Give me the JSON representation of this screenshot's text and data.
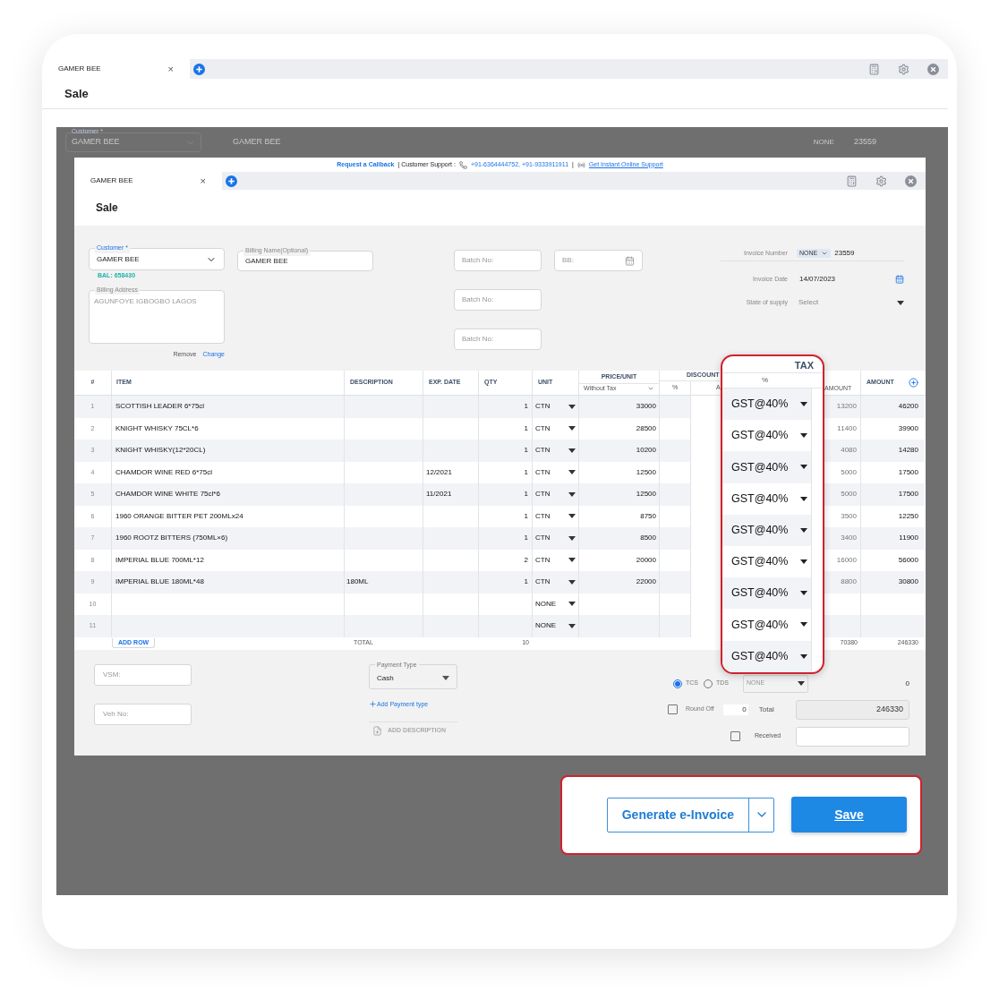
{
  "app": {
    "tab": "GAMER BEE",
    "close": "×",
    "title": "Sale"
  },
  "background_form": {
    "customer_label": "Customer *",
    "customer": "GAMER BEE",
    "billing_name": "GAMER BEE",
    "invoice_prefix": "NONE",
    "invoice_number": "23559"
  },
  "support_bar": {
    "callback": "Request a Callback",
    "label": "| Customer Support :",
    "phones": "+91-6364444752, +91-9333911911",
    "separator": "|",
    "online": "Get Instant Online Support"
  },
  "window": {
    "tab": "GAMER BEE",
    "close": "×",
    "title": "Sale"
  },
  "form": {
    "customer_label": "Customer *",
    "customer": "GAMER BEE",
    "balance": "BAL: 658430",
    "billing_name_label": "Billing Name(Optional)",
    "billing_name": "GAMER BEE",
    "address_label": "Billing Address",
    "address": "AGUNFOYE IGBOGBO LAGOS",
    "remove": "Remove",
    "change": "Change",
    "batch_fields": [
      "Batch No:",
      "Batch No:",
      "Batch No:"
    ],
    "bb_field": "BB:",
    "invoice_number_label": "Invoice Number",
    "invoice_prefix": "NONE",
    "invoice_number": "23559",
    "invoice_date_label": "Invoice Date",
    "invoice_date": "14/07/2023",
    "state_label": "State of supply",
    "state": "Select"
  },
  "table": {
    "header": {
      "number": "#",
      "item": "ITEM",
      "description": "DESCRIPTION",
      "exp_date": "EXP. DATE",
      "qty": "QTY",
      "unit": "UNIT",
      "price": "PRICE/UNIT",
      "price_mode": "Without Tax",
      "discount": "DISCOUNT",
      "discount_percent": "%",
      "discount_amount": "A",
      "tax_amount": "AMOUNT",
      "amount": "AMOUNT"
    },
    "rows": [
      {
        "number": "1",
        "item": "SCOTTISH LEADER 6*75cl",
        "qty": "1",
        "unit": "CTN",
        "price": "33000",
        "tax_amount": "13200",
        "amount": "46200"
      },
      {
        "number": "2",
        "item": "KNIGHT WHISKY 75CL*6",
        "qty": "1",
        "unit": "CTN",
        "price": "28500",
        "tax_amount": "11400",
        "amount": "39900"
      },
      {
        "number": "3",
        "item": "KNIGHT WHISKY(12*20CL)",
        "qty": "1",
        "unit": "CTN",
        "price": "10200",
        "tax_amount": "4080",
        "amount": "14280"
      },
      {
        "number": "4",
        "item": "CHAMDOR WINE RED 6*75cl",
        "exp_date": "12/2021",
        "qty": "1",
        "unit": "CTN",
        "price": "12500",
        "tax_amount": "5000",
        "amount": "17500"
      },
      {
        "number": "5",
        "item": "CHAMDOR WINE WHITE 75cl*6",
        "exp_date": "11/2021",
        "qty": "1",
        "unit": "CTN",
        "price": "12500",
        "tax_amount": "5000",
        "amount": "17500"
      },
      {
        "number": "6",
        "item": "1960 ORANGE BITTER PET 200MLx24",
        "qty": "1",
        "unit": "CTN",
        "price": "8750",
        "tax_amount": "3500",
        "amount": "12250"
      },
      {
        "number": "7",
        "item": "1960 ROOTZ BITTERS (750ML×6)",
        "qty": "1",
        "unit": "CTN",
        "price": "8500",
        "tax_amount": "3400",
        "amount": "11900"
      },
      {
        "number": "8",
        "item": "IMPERIAL BLUE 700ML*12",
        "qty": "2",
        "unit": "CTN",
        "price": "20000",
        "tax_amount": "16000",
        "amount": "56000"
      },
      {
        "number": "9",
        "item": "IMPERIAL BLUE 180ML*48",
        "description": "180ML",
        "qty": "1",
        "unit": "CTN",
        "price": "22000",
        "tax_amount": "8800",
        "amount": "30800"
      },
      {
        "number": "10",
        "unit": "NONE"
      },
      {
        "number": "11",
        "unit": "NONE"
      }
    ],
    "total": {
      "add_row": "ADD ROW",
      "label": "TOTAL",
      "qty": "10",
      "tax_amount": "70380",
      "amount": "246330"
    }
  },
  "tax_overlay": {
    "title": "TAX",
    "subheading": "%",
    "values": [
      "GST@40%",
      "GST@40%",
      "GST@40%",
      "GST@40%",
      "GST@40%",
      "GST@40%",
      "GST@40%",
      "GST@40%",
      "GST@40%"
    ]
  },
  "footer": {
    "vsm": "VSM:",
    "veh_no": "Veh No:",
    "payment_type_label": "Payment Type",
    "payment_type": "Cash",
    "add_payment": "Add Payment type",
    "add_description": "ADD DESCRIPTION",
    "radios": [
      {
        "label": "TCS",
        "selected": true
      },
      {
        "label": "TDS",
        "selected": false
      }
    ],
    "tax_select": "NONE",
    "tax_value": "0",
    "round_off": {
      "label": "Round Off",
      "checked": false,
      "value": "0"
    },
    "total_label": "Total",
    "total": "246330",
    "received": {
      "label": "Received",
      "checked": false
    }
  },
  "actions": {
    "generate": "Generate e-Invoice",
    "save": "Save"
  }
}
